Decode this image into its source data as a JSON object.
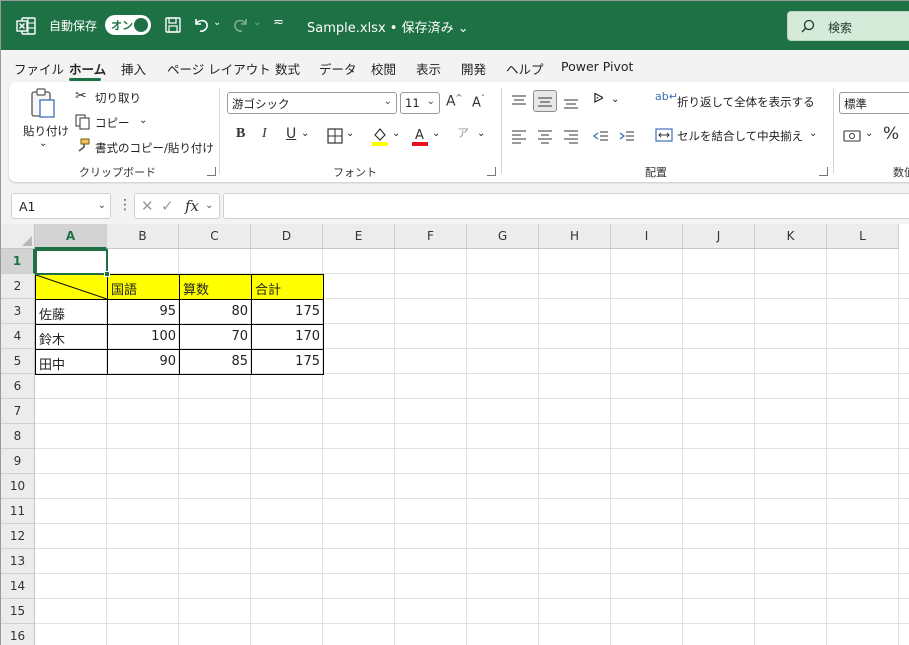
{
  "titlebar": {
    "autosave_label": "自動保存",
    "toggle_label": "オン",
    "document_title": "Sample.xlsx • 保存済み",
    "search_label": "検索"
  },
  "menu": {
    "tabs": [
      "ファイル",
      "ホーム",
      "挿入",
      "ページ レイアウト",
      "数式",
      "データ",
      "校閲",
      "表示",
      "開発",
      "ヘルプ",
      "Power Pivot"
    ],
    "active": "ホーム"
  },
  "ribbon": {
    "clipboard": {
      "paste_label": "貼り付け",
      "cut_label": "切り取り",
      "copy_label": "コピー",
      "format_painter_label": "書式のコピー/貼り付け",
      "group_label": "クリップボード"
    },
    "font": {
      "font_name": "游ゴシック",
      "font_size": "11",
      "group_label": "フォント"
    },
    "alignment": {
      "wrap_label": "折り返して全体を表示する",
      "merge_label": "セルを結合して中央揃え",
      "group_label": "配置"
    },
    "number": {
      "format": "標準",
      "group_label": "数值"
    }
  },
  "formula_bar": {
    "name_box": "A1",
    "formula": ""
  },
  "sheet": {
    "columns": [
      "A",
      "B",
      "C",
      "D",
      "E",
      "F",
      "G",
      "H",
      "I",
      "J",
      "K",
      "L"
    ],
    "rows": [
      "1",
      "2",
      "3",
      "4",
      "5",
      "6",
      "7",
      "8",
      "9",
      "10",
      "11",
      "12",
      "13",
      "14",
      "15",
      "16"
    ],
    "table_header": [
      "国語",
      "算数",
      "合計"
    ],
    "table_rows": [
      {
        "name": "佐藤",
        "kokugo": "95",
        "sansu": "80",
        "total": "175"
      },
      {
        "name": "鈴木",
        "kokugo": "100",
        "sansu": "70",
        "total": "170"
      },
      {
        "name": "田中",
        "kokugo": "90",
        "sansu": "85",
        "total": "175"
      }
    ]
  },
  "colors": {
    "excel_green": "#1e7145",
    "header_fill": "#ffff00"
  }
}
